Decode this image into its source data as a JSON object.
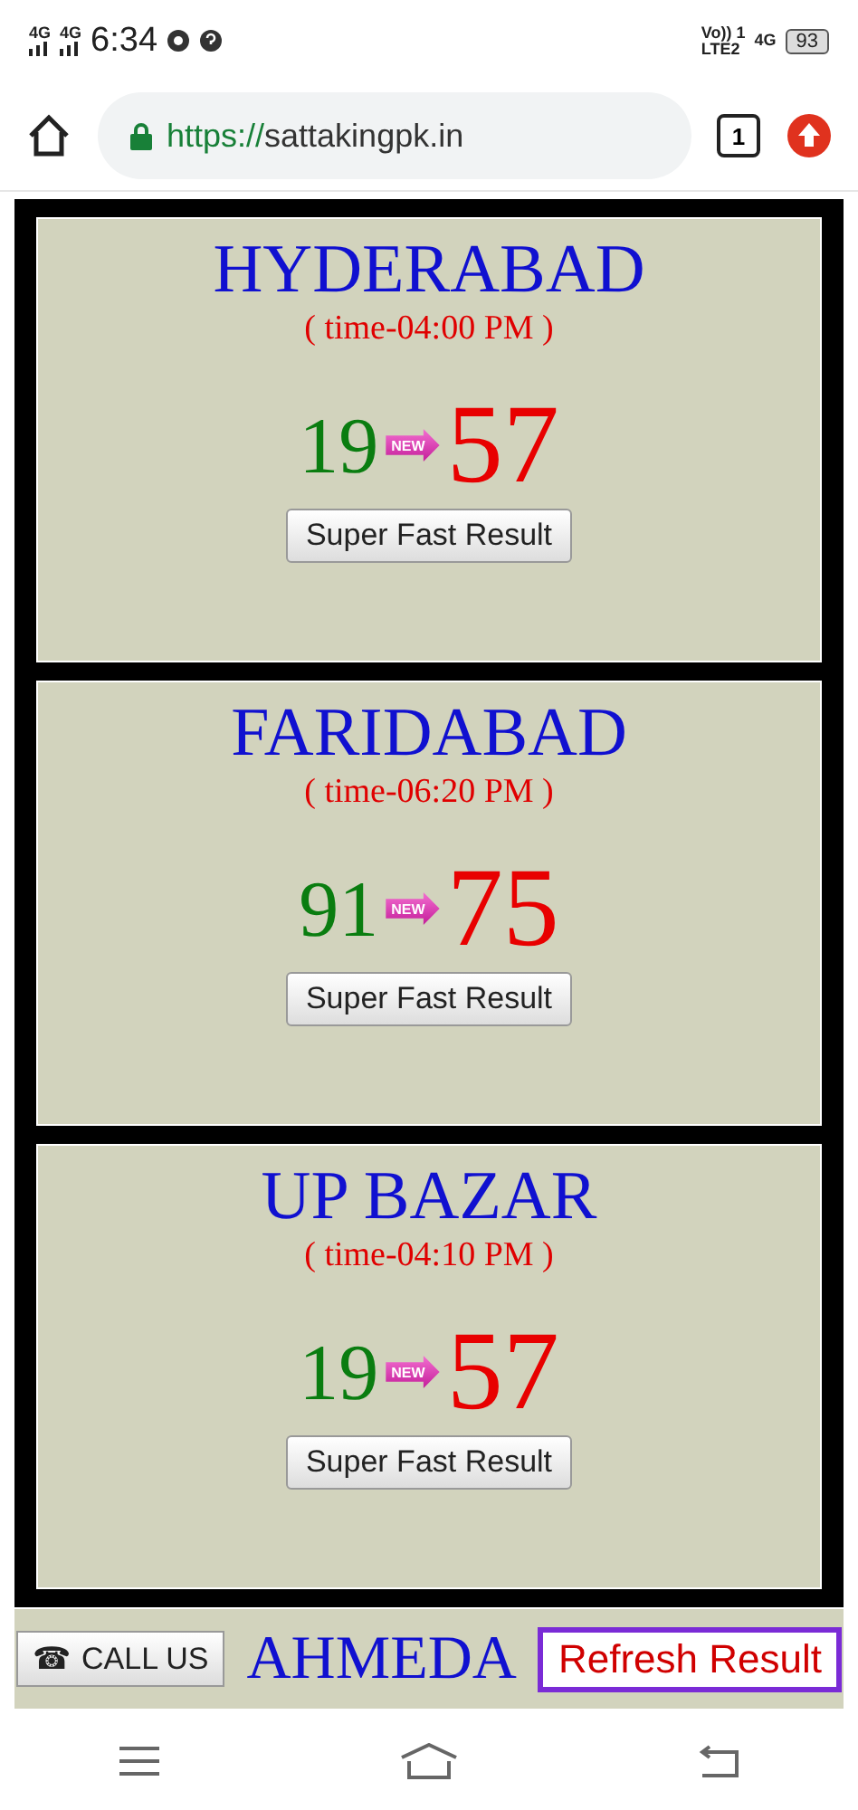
{
  "status_bar": {
    "network_1": "4G",
    "network_2": "4G",
    "time": "6:34",
    "volte": "Vo)) 1",
    "lte": "LTE2",
    "network_3": "4G",
    "battery": "93"
  },
  "browser": {
    "url_scheme": "https://",
    "url_host": "sattakingpk.in",
    "tab_count": "1"
  },
  "results": [
    {
      "city": "HYDERABAD",
      "time": "( time-04:00 PM )",
      "old": "19",
      "badge": "NEW",
      "new": "57",
      "button": "Super Fast Result"
    },
    {
      "city": "FARIDABAD",
      "time": "( time-06:20 PM )",
      "old": "91",
      "badge": "NEW",
      "new": "75",
      "button": "Super Fast Result"
    },
    {
      "city": "UP BAZAR",
      "time": "( time-04:10 PM )",
      "old": "19",
      "badge": "NEW",
      "new": "57",
      "button": "Super Fast Result"
    }
  ],
  "partial_card": {
    "city": "AHMEDA"
  },
  "call_button": {
    "icon": "☎",
    "label": "CALL US"
  },
  "refresh_button": "Refresh Result"
}
